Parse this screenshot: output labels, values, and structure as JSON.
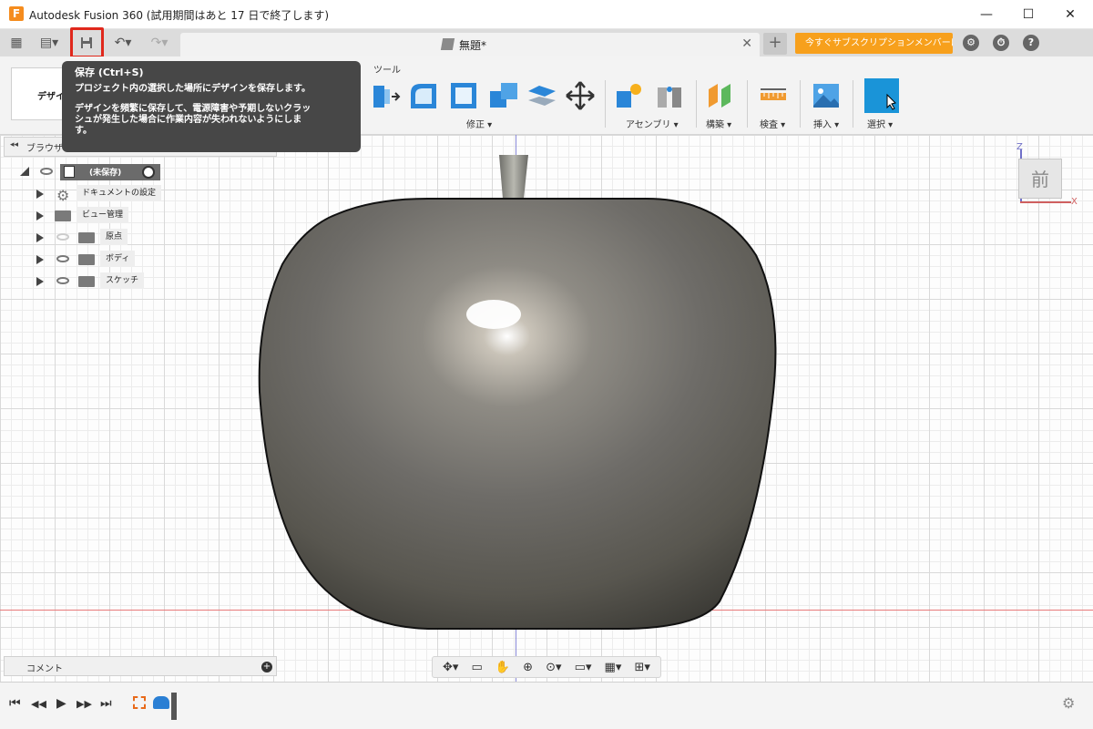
{
  "window": {
    "app_icon_letter": "F",
    "title": "Autodesk Fusion 360 (試用期間はあと 17 日で終了します)",
    "minimize": "—",
    "maximize": "☐",
    "close": "✕"
  },
  "tabbar": {
    "grid_menu": "▦",
    "file_menu": "▤▾",
    "save": "💾",
    "undo": "↶▾",
    "redo": "↷▾",
    "doc_tab_label": "無題*",
    "doc_tab_close": "✕",
    "new_tab": "+",
    "promo": "今すぐサブスクリプションメンバーに...",
    "extensions_icon": "⚙",
    "history_icon": "⏱",
    "help_icon": "?"
  },
  "ribbon": {
    "workspace": "デザイ",
    "tools_label": "ツール",
    "groups": [
      {
        "label": "修正 ▾"
      },
      {
        "label": "アセンブリ ▾"
      },
      {
        "label": "構築 ▾"
      },
      {
        "label": "検査 ▾"
      },
      {
        "label": "挿入 ▾"
      },
      {
        "label": "選択 ▾"
      }
    ]
  },
  "tooltip": {
    "title": "保存 (Ctrl+S)",
    "line1": "プロジェクト内の選択した場所にデザインを保存します。",
    "line2": "デザインを頻繁に保存して、電源障害や予期しないクラッ",
    "line3": "シュが発生した場合に作業内容が失われないようにしま",
    "line4": "す。"
  },
  "browser": {
    "header": "ブラウザ",
    "collapse": "◂◂",
    "root": "(未保存)",
    "items": [
      {
        "label": "ドキュメントの設定"
      },
      {
        "label": "ビュー管理"
      },
      {
        "label": "原点"
      },
      {
        "label": "ボディ"
      },
      {
        "label": "スケッチ"
      }
    ]
  },
  "comments": {
    "label": "コメント",
    "add": "+"
  },
  "viewcube": {
    "face": "前",
    "z": "Z",
    "x": "X"
  },
  "navbar": {
    "orbit": "✥▾",
    "look_at": "▭",
    "pan": "✋",
    "zoom": "⊕",
    "fit": "⊙▾",
    "display": "▭▾",
    "grid": "▦▾",
    "viewports": "⊞▾"
  },
  "timeline": {
    "first": "⏮",
    "prev": "◀◀",
    "play": "▶",
    "next": "▶▶",
    "last": "⏭",
    "settings": "⚙"
  },
  "colors": {
    "accent_orange": "#f7a01c",
    "highlight_red": "#e0281c",
    "select_blue": "#1a94d8",
    "tooltip_bg": "#474747"
  }
}
